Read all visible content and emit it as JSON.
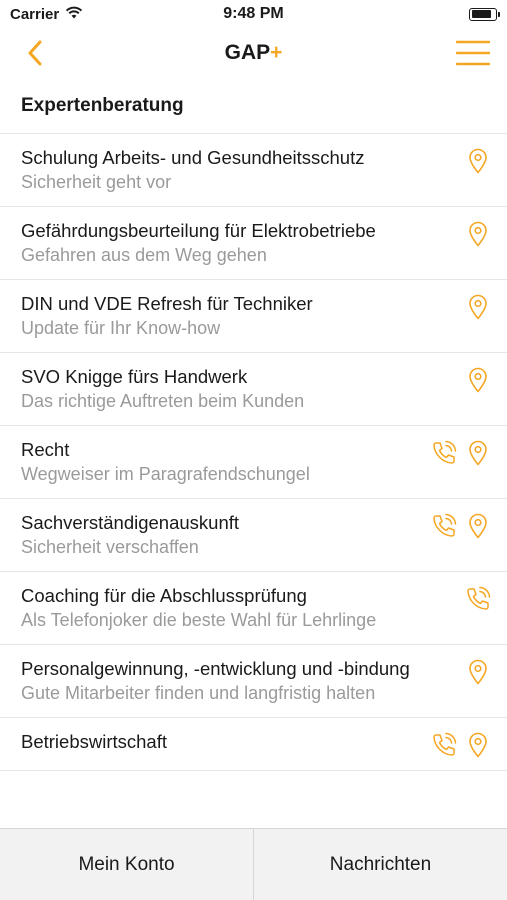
{
  "status": {
    "carrier": "Carrier",
    "time": "9:48 PM",
    "battery_level": 0.85
  },
  "nav": {
    "title": "GAP",
    "title_suffix": "+",
    "accent": "#f5a623"
  },
  "section": {
    "title": "Expertenberatung"
  },
  "items": [
    {
      "title": "Schulung Arbeits- und Gesundheitsschutz",
      "subtitle": "Sicherheit geht vor",
      "icons": [
        "location-pin-icon"
      ]
    },
    {
      "title": "Gefährdungsbeurteilung für Elektrobetriebe",
      "subtitle": "Gefahren aus dem Weg gehen",
      "icons": [
        "location-pin-icon"
      ]
    },
    {
      "title": "DIN und VDE Refresh für Techniker",
      "subtitle": "Update für Ihr Know-how",
      "icons": [
        "location-pin-icon"
      ]
    },
    {
      "title": "SVO Knigge fürs Handwerk",
      "subtitle": "Das richtige Auftreten beim Kunden",
      "icons": [
        "location-pin-icon"
      ]
    },
    {
      "title": "Recht",
      "subtitle": "Wegweiser im Paragrafendschungel",
      "icons": [
        "phone-call-icon",
        "location-pin-icon"
      ]
    },
    {
      "title": "Sachverständigenauskunft",
      "subtitle": "Sicherheit verschaffen",
      "icons": [
        "phone-call-icon",
        "location-pin-icon"
      ]
    },
    {
      "title": "Coaching für die Abschlussprüfung",
      "subtitle": "Als Telefonjoker die beste Wahl für Lehrlinge",
      "icons": [
        "phone-call-icon"
      ]
    },
    {
      "title": "Personalgewinnung, -entwicklung und -bindung",
      "subtitle": "Gute Mitarbeiter finden und langfristig halten",
      "icons": [
        "location-pin-icon"
      ]
    },
    {
      "title": "Betriebswirtschaft",
      "subtitle": "",
      "icons": [
        "phone-call-icon",
        "location-pin-icon"
      ]
    }
  ],
  "tabs": {
    "account": "Mein Konto",
    "messages": "Nachrichten"
  }
}
